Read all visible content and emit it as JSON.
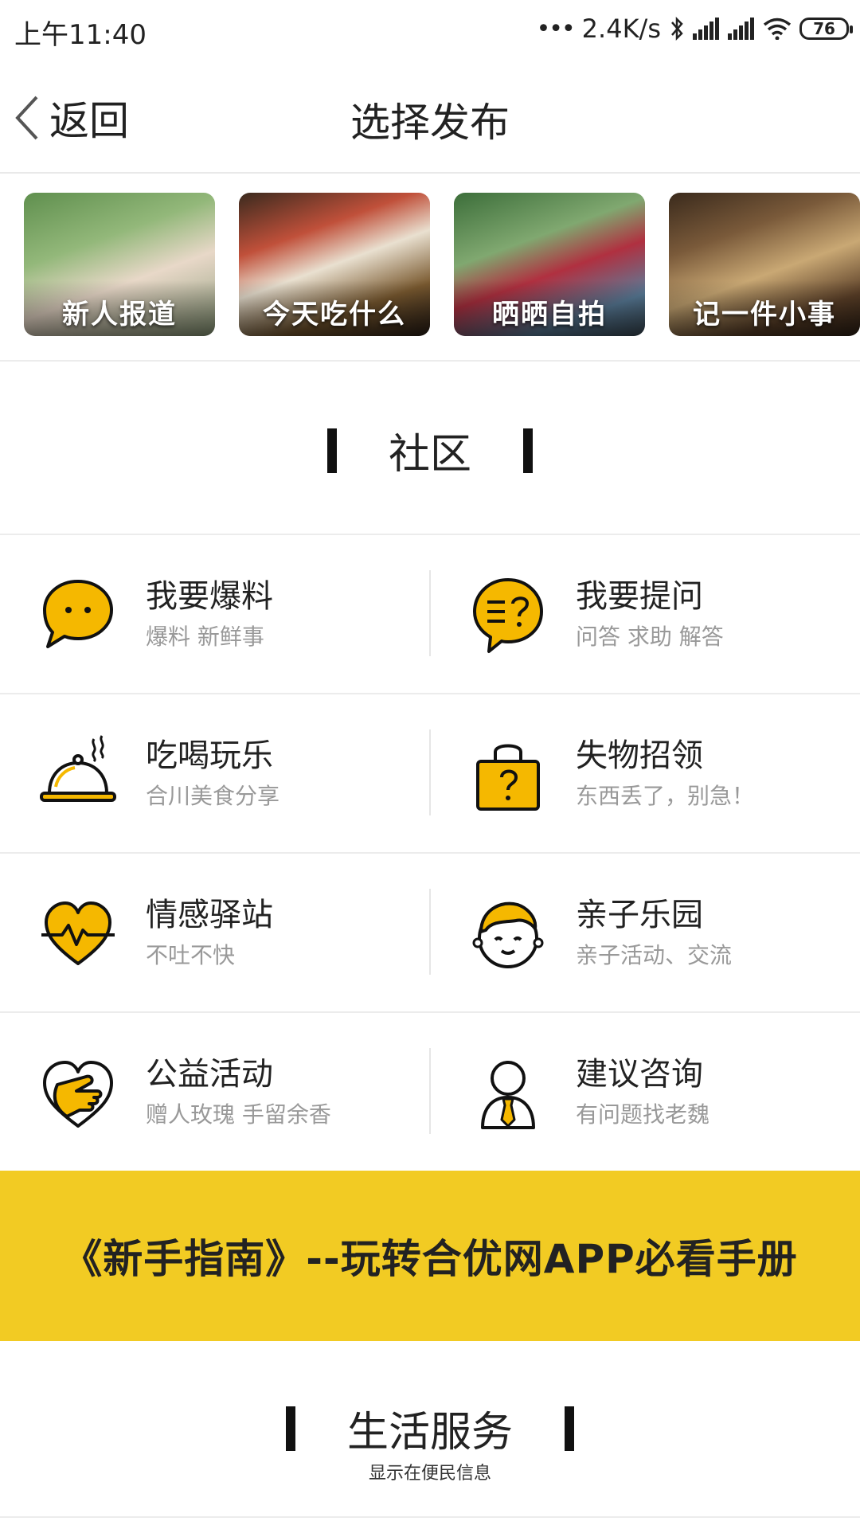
{
  "status_bar": {
    "time": "上午11:40",
    "network_speed": "2.4K/s",
    "battery": "76"
  },
  "nav": {
    "back_label": "返回",
    "title": "选择发布"
  },
  "categories": [
    {
      "label": "新人报道"
    },
    {
      "label": "今天吃什么"
    },
    {
      "label": "晒晒自拍"
    },
    {
      "label": "记一件小事"
    }
  ],
  "community": {
    "title": "社区",
    "items": [
      {
        "title": "我要爆料",
        "subtitle": "爆料 新鲜事",
        "icon": "chat-bubble-icon"
      },
      {
        "title": "我要提问",
        "subtitle": "问答 求助  解答",
        "icon": "question-bubble-icon"
      },
      {
        "title": "吃喝玩乐",
        "subtitle": "合川美食分享",
        "icon": "food-cloche-icon"
      },
      {
        "title": "失物招领",
        "subtitle": "东西丢了，别急！",
        "icon": "lost-lock-icon"
      },
      {
        "title": "情感驿站",
        "subtitle": "不吐不快",
        "icon": "heart-pulse-icon"
      },
      {
        "title": "亲子乐园",
        "subtitle": "亲子活动、交流",
        "icon": "child-face-icon"
      },
      {
        "title": "公益活动",
        "subtitle": "赠人玫瑰 手留余香",
        "icon": "handshake-heart-icon"
      },
      {
        "title": "建议咨询",
        "subtitle": "有问题找老魏",
        "icon": "person-tie-icon"
      }
    ]
  },
  "banner": {
    "text": "《新手指南》--玩转合优网APP必看手册",
    "color": "#f2cb23"
  },
  "life_service": {
    "title": "生活服务",
    "subtitle": "显示在便民信息"
  },
  "colors": {
    "accent": "#f5b800",
    "divider": "#ececec",
    "subtitle": "#999999"
  }
}
